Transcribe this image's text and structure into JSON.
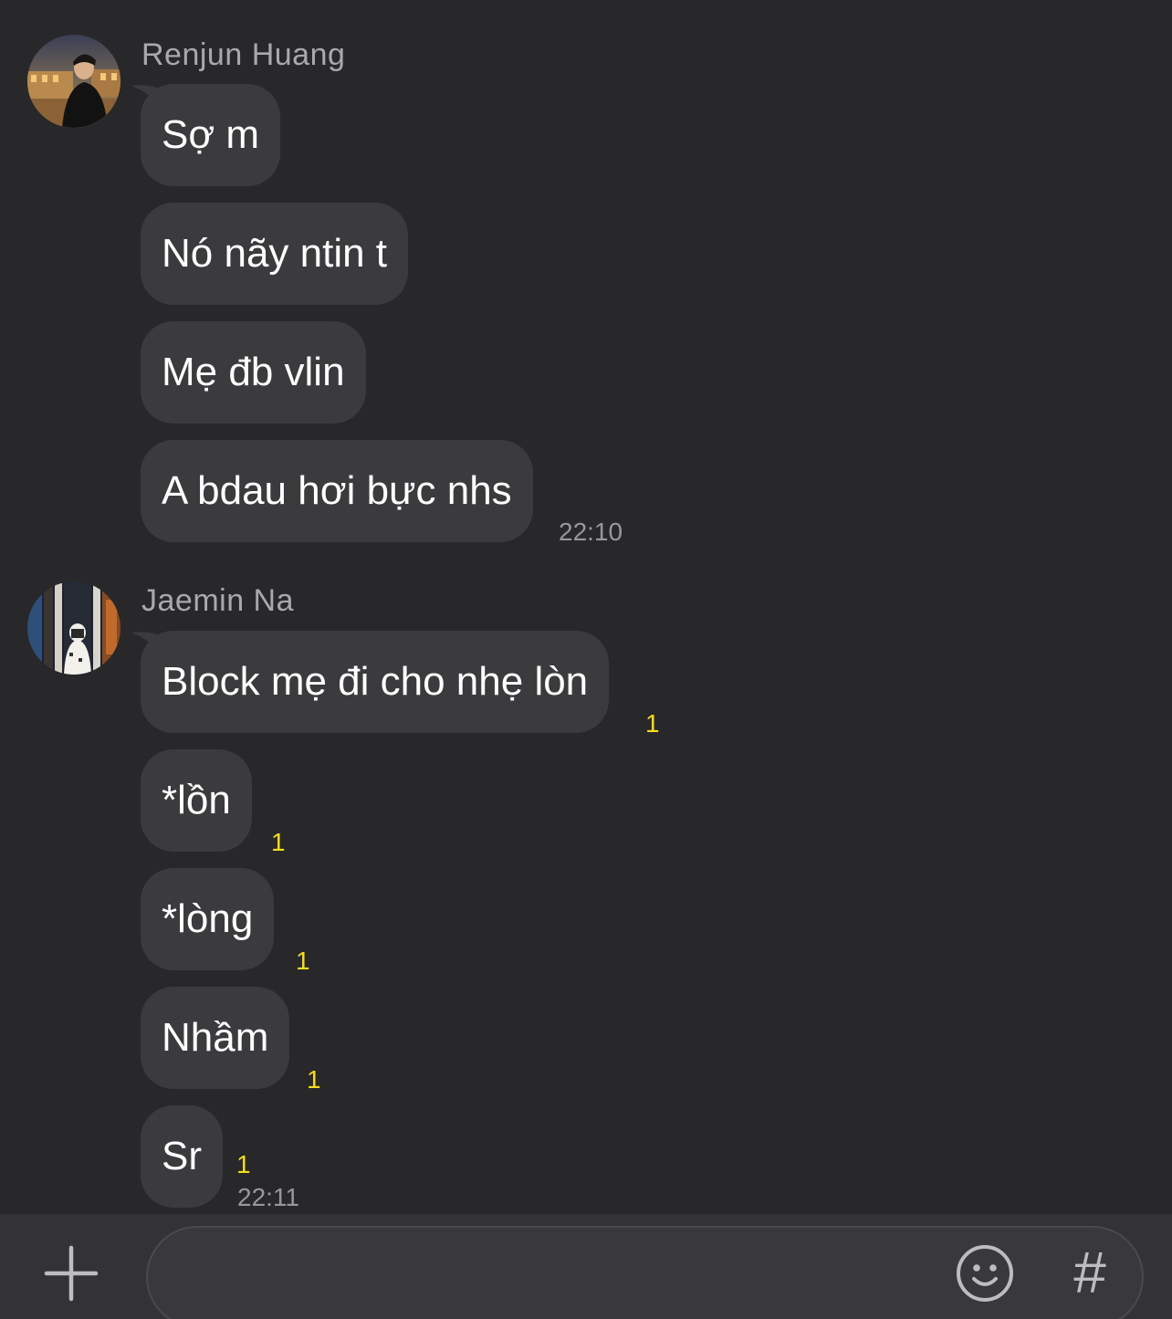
{
  "groups": [
    {
      "sender": "Renjun Huang",
      "messages": [
        {
          "text": "Sợ m",
          "unread": ""
        },
        {
          "text": "Nó nãy ntin t",
          "unread": ""
        },
        {
          "text": "Mẹ đb vlin",
          "unread": ""
        },
        {
          "text": "A bdau hơi bực nhs",
          "unread": ""
        }
      ],
      "time": "22:10"
    },
    {
      "sender": "Jaemin Na",
      "messages": [
        {
          "text": "Block mẹ đi cho nhẹ lòn",
          "unread": "1"
        },
        {
          "text": "*lồn",
          "unread": "1"
        },
        {
          "text": "*lòng",
          "unread": "1"
        },
        {
          "text": "Nhầm",
          "unread": "1"
        },
        {
          "text": "Sr",
          "unread": "1"
        }
      ],
      "time": "22:11"
    }
  ],
  "input_bar": {
    "value": "",
    "placeholder": "",
    "plus_icon": "plus-icon",
    "emoji_icon": "emoji-smiley-icon",
    "hash_label": "#"
  },
  "colors": {
    "background": "#28282a",
    "bubble": "#3b3b3e",
    "unread_count": "#f5dc1e",
    "timestamp": "#98989c"
  }
}
